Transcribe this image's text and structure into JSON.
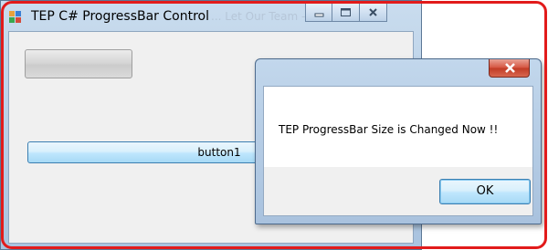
{
  "main_window": {
    "title": "TEP C# ProgressBar Control",
    "ghost_text": "...  Let Our Team  -  member",
    "app_icon": "form-icon",
    "controls": {
      "minimize_icon": "minimize-icon",
      "maximize_icon": "maximize-icon",
      "close_icon": "close-icon"
    },
    "progress_bar": {
      "value": 0
    },
    "button1_label": "button1"
  },
  "dialog": {
    "close_icon": "close-icon",
    "message": "TEP ProgressBar Size is Changed Now !!",
    "ok_label": "OK"
  },
  "colors": {
    "annotation_border": "#e21b1b",
    "button_border": "#3c7fb1",
    "dialog_close": "#c03a24"
  }
}
